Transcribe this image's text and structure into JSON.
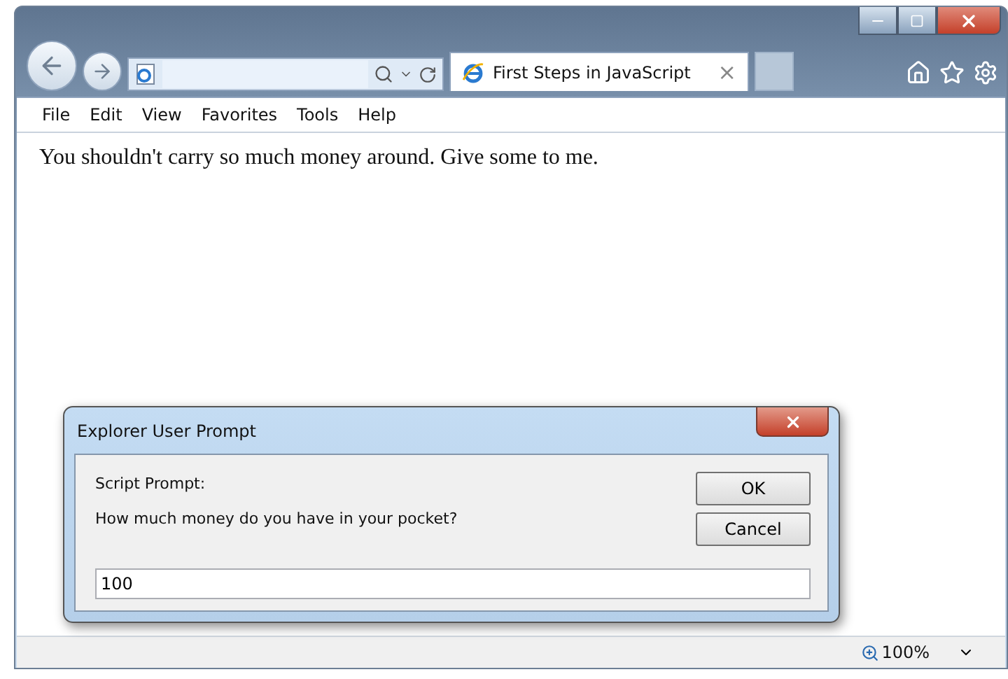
{
  "browser": {
    "tab": {
      "title": "First Steps in JavaScript",
      "close": "×"
    }
  },
  "menu": [
    {
      "label": "File"
    },
    {
      "label": "Edit"
    },
    {
      "label": "View"
    },
    {
      "label": "Favorites"
    },
    {
      "label": "Tools"
    },
    {
      "label": "Help"
    }
  ],
  "page_text": "You shouldn't carry so much money around. Give some to me.",
  "dialog": {
    "title": "Explorer User Prompt",
    "heading": "Script Prompt:",
    "question": "How much money do you have in your pocket?",
    "value": "100",
    "buttons": [
      {
        "label": "OK"
      },
      {
        "label": "Cancel"
      }
    ]
  },
  "status_bar": {
    "zoom": "100%"
  }
}
